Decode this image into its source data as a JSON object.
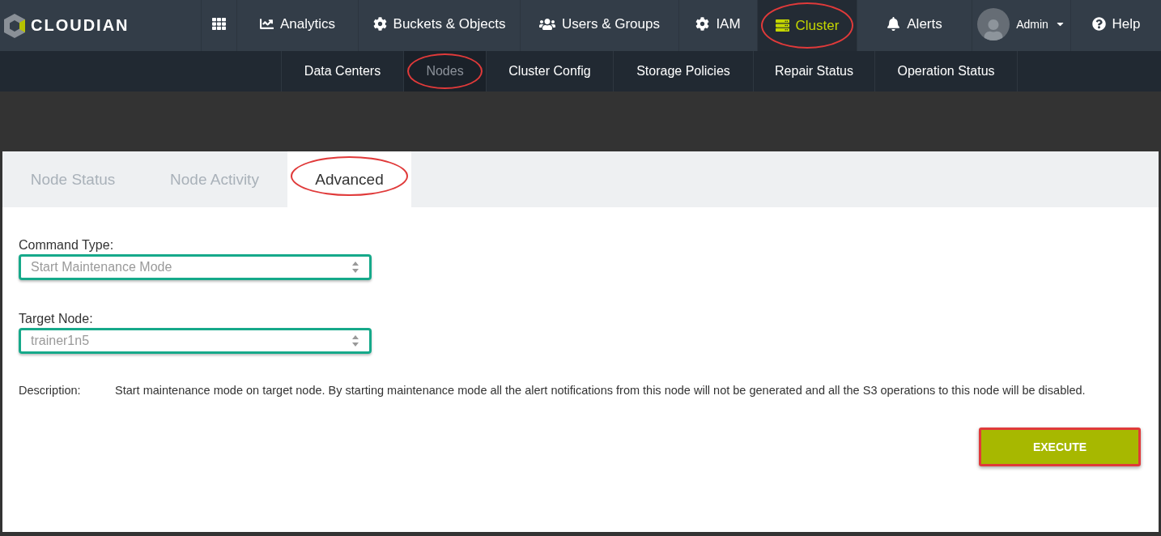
{
  "brand": {
    "name": "CLOUDIAN"
  },
  "nav": [
    {
      "kind": "grid",
      "selected": false,
      "annotated": false
    },
    {
      "kind": "chart",
      "label": "Analytics",
      "selected": false,
      "annotated": false
    },
    {
      "kind": "gear",
      "label": "Buckets & Objects",
      "selected": false,
      "annotated": false
    },
    {
      "kind": "users",
      "label": "Users & Groups",
      "selected": false,
      "annotated": false
    },
    {
      "kind": "gear",
      "label": "IAM",
      "selected": false,
      "annotated": false
    },
    {
      "kind": "server",
      "label": "Cluster",
      "selected": true,
      "annotated": true
    },
    {
      "kind": "bell",
      "label": "Alerts",
      "selected": false,
      "annotated": false
    },
    {
      "kind": "user",
      "label": "Admin",
      "selected": false,
      "annotated": false
    },
    {
      "kind": "help",
      "label": "Help",
      "selected": false,
      "annotated": false
    }
  ],
  "subnav": [
    {
      "label": "Data Centers",
      "selected": false,
      "annotated": false
    },
    {
      "label": "Nodes",
      "selected": true,
      "annotated": true
    },
    {
      "label": "Cluster Config",
      "selected": false,
      "annotated": false
    },
    {
      "label": "Storage Policies",
      "selected": false,
      "annotated": false
    },
    {
      "label": "Repair Status",
      "selected": false,
      "annotated": false
    },
    {
      "label": "Operation Status",
      "selected": false,
      "annotated": false
    }
  ],
  "tabs": [
    {
      "label": "Node Status",
      "selected": false,
      "annotated": false
    },
    {
      "label": "Node Activity",
      "selected": false,
      "annotated": false
    },
    {
      "label": "Advanced",
      "selected": true,
      "annotated": true
    }
  ],
  "form": {
    "fields": [
      {
        "label": "Command Type:",
        "value": "Start Maintenance Mode",
        "highlighted": true
      },
      {
        "label": "Target Node:",
        "value": "trainer1n5",
        "highlighted": true
      }
    ],
    "description_label": "Description:",
    "description": "Start maintenance mode on target node. By starting maintenance mode all the alert notifications from this node will not be generated and all the S3 operations to this node will be disabled.",
    "button": {
      "label": "EXECUTE",
      "highlighted": true
    }
  }
}
